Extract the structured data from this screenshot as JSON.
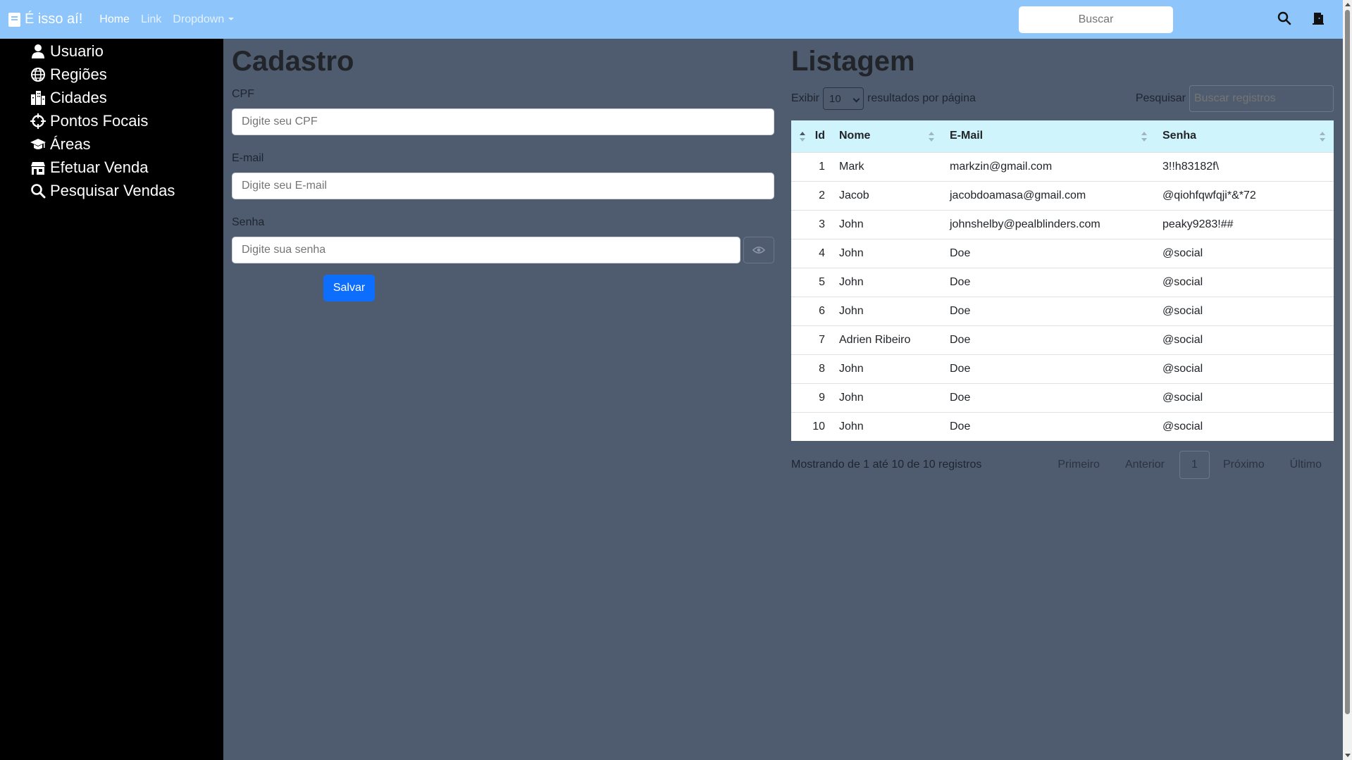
{
  "navbar": {
    "brand": "É isso aí!",
    "links": [
      "Home",
      "Link",
      "Dropdown"
    ],
    "search_label": "Buscar",
    "icons": [
      "search-icon",
      "door-icon"
    ],
    "color": "#8ec5fb"
  },
  "sidebar": {
    "items": [
      {
        "label": "Usuario",
        "icon": "user-icon"
      },
      {
        "label": "Regiões",
        "icon": "globe-icon"
      },
      {
        "label": "Cidades",
        "icon": "city-icon"
      },
      {
        "label": "Pontos Focais",
        "icon": "crosshair-icon"
      },
      {
        "label": "Áreas",
        "icon": "graduation-cap-icon"
      },
      {
        "label": "Efetuar Venda",
        "icon": "store-icon"
      },
      {
        "label": "Pesquisar Vendas",
        "icon": "search-icon"
      }
    ]
  },
  "cadastro": {
    "title": "Cadastro",
    "cpf_label": "CPF",
    "cpf_placeholder": "Digite seu CPF",
    "email_label": "E-mail",
    "email_placeholder": "Digite seu E-mail",
    "senha_label": "Senha",
    "senha_placeholder": "Digite sua senha",
    "save_label": "Salvar",
    "save_color": "#0d6efd"
  },
  "listagem": {
    "title": "Listagem",
    "show_label": "Exibir",
    "page_size": "10",
    "per_page_label": "resultados por página",
    "search_label": "Pesquisar",
    "search_placeholder": "Buscar registros",
    "columns": [
      "Id",
      "Nome",
      "E-Mail",
      "Senha"
    ],
    "rows": [
      {
        "id": "1",
        "nome": "Mark",
        "email": "markzin@gmail.com",
        "senha": "3!!h83182f\\"
      },
      {
        "id": "2",
        "nome": "Jacob",
        "email": "jacobdoamasa@gmail.com",
        "senha": "@qiohfqwfqji*&*72"
      },
      {
        "id": "3",
        "nome": "John",
        "email": "johnshelby@pealblinders.com",
        "senha": "peaky9283!##"
      },
      {
        "id": "4",
        "nome": "John",
        "email": "Doe",
        "senha": "@social"
      },
      {
        "id": "5",
        "nome": "John",
        "email": "Doe",
        "senha": "@social"
      },
      {
        "id": "6",
        "nome": "John",
        "email": "Doe",
        "senha": "@social"
      },
      {
        "id": "7",
        "nome": "Adrien Ribeiro",
        "email": "Doe",
        "senha": "@social"
      },
      {
        "id": "8",
        "nome": "John",
        "email": "Doe",
        "senha": "@social"
      },
      {
        "id": "9",
        "nome": "John",
        "email": "Doe",
        "senha": "@social"
      },
      {
        "id": "10",
        "nome": "John",
        "email": "Doe",
        "senha": "@social"
      }
    ],
    "info": "Mostrando de 1 até 10 de 10 registros",
    "pagination": {
      "first": "Primeiro",
      "previous": "Anterior",
      "current": "1",
      "next": "Próximo",
      "last": "Último"
    },
    "header_color": "#cff4fc"
  }
}
